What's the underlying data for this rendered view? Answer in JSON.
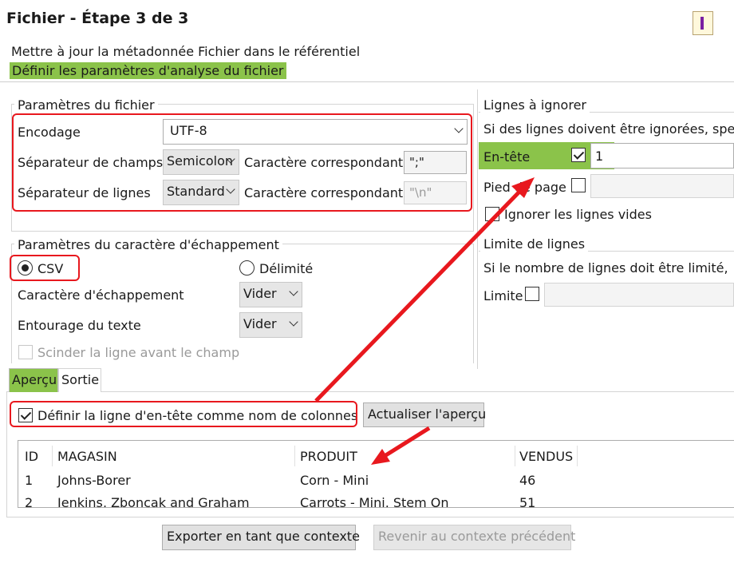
{
  "window": {
    "title": "Fichier - Étape 3 de 3",
    "subtitle": "Mettre à jour la métadonnée Fichier dans le référentiel",
    "step_label": "Définir les paramètres d'analyse du fichier"
  },
  "file_params": {
    "legend": "Paramètres du fichier",
    "encoding_label": "Encodage",
    "encoding_value": "UTF-8",
    "field_sep_label": "Séparateur de champs",
    "field_sep_value": "Semicolon",
    "field_sep_char_label": "Caractère correspondant",
    "field_sep_char_value": "\";\"",
    "row_sep_label": "Séparateur de lignes",
    "row_sep_value": "Standard",
    "row_sep_char_label": "Caractère correspondant",
    "row_sep_char_value": "\"\\n\""
  },
  "escape_params": {
    "legend": "Paramètres du caractère d'échappement",
    "csv_label": "CSV",
    "delimited_label": "Délimité",
    "escape_char_label": "Caractère d'échappement",
    "escape_char_value": "Vider",
    "enclosure_label": "Entourage du texte",
    "enclosure_value": "Vider",
    "split_label": "Scinder la ligne avant le champ"
  },
  "ignore_rows": {
    "legend": "Lignes à ignorer",
    "description": "Si des lignes doivent être ignorées, spe",
    "header_label": "En-tête",
    "header_checked": true,
    "header_value": "1",
    "footer_label": "Pied de page",
    "footer_checked": false,
    "empty_label": "Ignorer les lignes vides"
  },
  "row_limit": {
    "legend": "Limite de lignes",
    "description": "Si le nombre de lignes doit être limité,",
    "limit_label": "Limite",
    "limit_checked": false
  },
  "tabs": [
    {
      "label": "Aperçu",
      "selected": true
    },
    {
      "label": "Sortie",
      "selected": false
    }
  ],
  "preview": {
    "header_checkbox_label": "Définir la ligne d'en-tête comme nom de colonnes",
    "header_checked": true,
    "refresh_button": "Actualiser l'aperçu",
    "columns": [
      "ID",
      "MAGASIN",
      "PRODUIT",
      "VENDUS"
    ],
    "rows": [
      [
        "1",
        "Johns-Borer",
        "Corn - Mini",
        "46"
      ],
      [
        "2",
        "Jenkins, Zboncak and Graham",
        "Carrots - Mini, Stem On",
        "51"
      ]
    ]
  },
  "footer": {
    "export_button": "Exporter en tant que contexte",
    "revert_button": "Revenir au contexte précédent"
  },
  "colors": {
    "highlight": "#8bc34a",
    "annotation": "#e8181e"
  }
}
